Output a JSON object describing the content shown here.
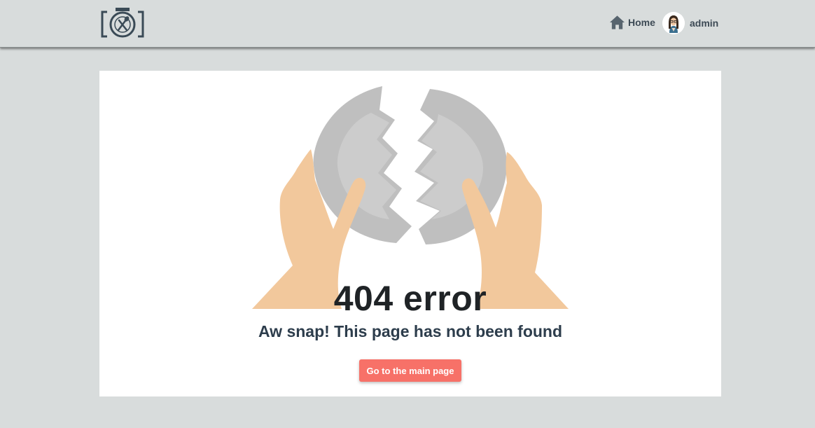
{
  "header": {
    "logo_icon": "camera-fork-knife-logo-icon",
    "nav": {
      "home_label": "Home",
      "home_icon": "home-icon",
      "user_label": "admin",
      "user_avatar": "avatar-icon"
    }
  },
  "error": {
    "code_text": "404 error",
    "message": "Aw snap! This page has not been found",
    "button_label": "Go to the main page",
    "illustration_icon": "broken-plate-icon"
  },
  "colors": {
    "background": "#d8dcdc",
    "card": "#ffffff",
    "accent_button": "#f77168",
    "heading": "#1f2326",
    "message": "#2d3d4c",
    "nav_text": "#3d4a55",
    "plate": "#bfbfbf",
    "plate_inner": "#cccccc",
    "hand": "#f2c89c"
  }
}
